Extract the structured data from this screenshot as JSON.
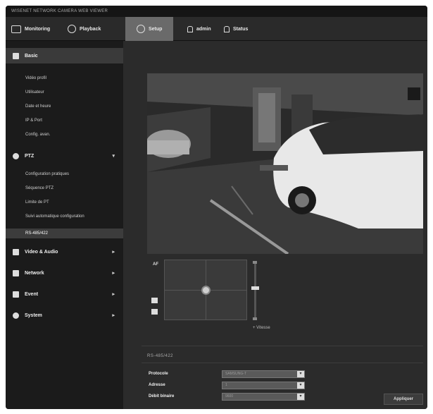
{
  "app": {
    "title": "WISENET NETWORK CAMERA WEB VIEWER"
  },
  "topnav": {
    "monitoring": "Monitoring",
    "playback": "Playback",
    "setup": "Setup",
    "admin": "admin",
    "status": "Status"
  },
  "sidebar": {
    "basic": {
      "label": "Basic",
      "items": [
        "Vidéo profil",
        "Utilisateur",
        "Date et heure",
        "IP & Port",
        "Config. avan."
      ]
    },
    "ptz": {
      "label": "PTZ",
      "items": [
        "Configuration pratiques",
        "Séquence PTZ",
        "Limite de PT",
        "Suivi automatique configuration",
        "RS-485/422"
      ]
    },
    "sections": [
      {
        "label": "Video & Audio"
      },
      {
        "label": "Network"
      },
      {
        "label": "Event"
      },
      {
        "label": "System"
      }
    ]
  },
  "main": {
    "ptz_af_label": "AF",
    "ptz_speed_label": "+ Vitesse",
    "panel_title": "RS-485/422",
    "fields": [
      {
        "label": "Protocole",
        "value": "SAMSUNG-T"
      },
      {
        "label": "Adresse",
        "value": "1"
      },
      {
        "label": "Débit binaire",
        "value": "9600"
      }
    ],
    "apply_label": "Appliquer"
  },
  "colors": {
    "background": "#1f1f1f",
    "active_tab": "#6a6a6a",
    "panel": "#2b2b2b"
  }
}
